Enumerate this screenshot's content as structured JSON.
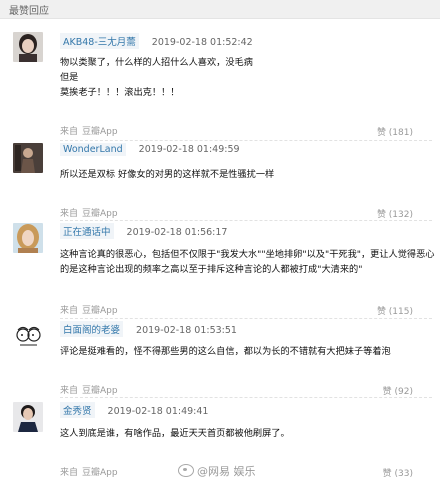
{
  "section_title": "最赞回应",
  "source_prefix": "来自",
  "source_app": "豆瓣App",
  "comments": [
    {
      "username": "AKB48-三尢月薷",
      "time": "2019-02-18 01:52:42",
      "lines": [
        "物以类聚了，什么样的人招什么人喜欢，没毛病",
        "但是",
        "莫挨老子！！！滚出克！！！"
      ],
      "likes": "赞 (181)"
    },
    {
      "username": "WonderLand",
      "time": "2019-02-18 01:49:59",
      "lines": [
        "所以还是双标 好像女的对男的这样就不是性骚扰一样"
      ],
      "likes": "赞 (132)"
    },
    {
      "username": "正在通话中",
      "time": "2019-02-18 01:56:17",
      "lines": [
        "这种言论真的很恶心，包括但不仅限于\"我发大水\"\"坐地排卵\"以及\"干死我\"，更让人觉得恶心",
        "的是这种言论出现的频率之高以至于排斥这种言论的人都被打成\"大清来的\""
      ],
      "likes": "赞 (115)"
    },
    {
      "username": "白面阁的老婆",
      "time": "2019-02-18 01:53:51",
      "lines": [
        "评论是挺难看的，怪不得那些男的这么自信，都以为长的不错就有大把妹子等着泡"
      ],
      "likes": "赞 (92)"
    },
    {
      "username": "金秀贤",
      "time": "2019-02-18 01:49:41",
      "lines": [
        "这人到底是谁，有啥作品，最近天天首页都被他刷屏了。"
      ],
      "likes": "赞 (33)"
    }
  ],
  "watermark": {
    "icon": "weibo-icon",
    "handle": "@网易 娱乐"
  }
}
